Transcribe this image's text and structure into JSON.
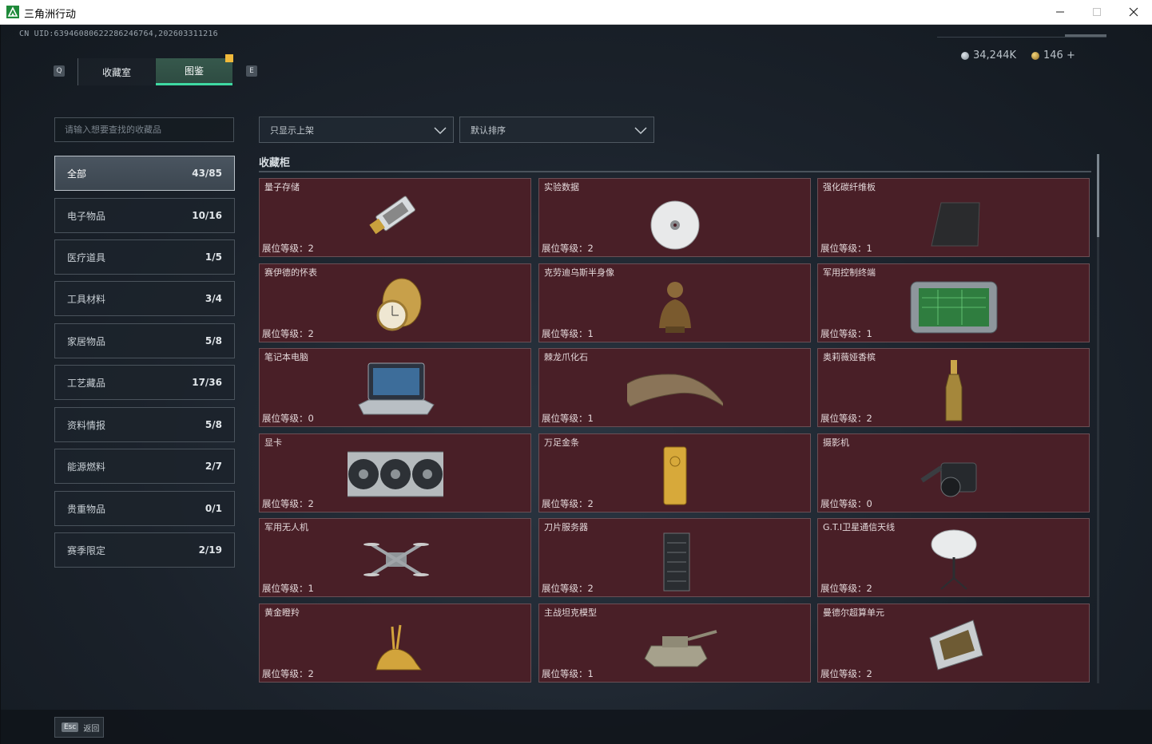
{
  "window": {
    "title": "三角洲行动"
  },
  "uid": "CN UID:6394608062228624676​4,202603311216",
  "tabs": {
    "prev_key": "Q",
    "next_key": "E",
    "collection": "收藏室",
    "gallery": "图鉴"
  },
  "currency": {
    "silver": "34,244K",
    "gold": "146 +"
  },
  "search": {
    "placeholder": "请输入想要查找的收藏品"
  },
  "categories": [
    {
      "label": "全部",
      "count": "43/85"
    },
    {
      "label": "电子物品",
      "count": "10/16"
    },
    {
      "label": "医疗道具",
      "count": "1/5"
    },
    {
      "label": "工具材料",
      "count": "3/4"
    },
    {
      "label": "家居物品",
      "count": "5/8"
    },
    {
      "label": "工艺藏品",
      "count": "17/36"
    },
    {
      "label": "资料情报",
      "count": "5/8"
    },
    {
      "label": "能源燃料",
      "count": "2/7"
    },
    {
      "label": "贵重物品",
      "count": "0/1"
    },
    {
      "label": "赛季限定",
      "count": "2/19"
    }
  ],
  "filters": {
    "show": "只显示上架",
    "sort": "默认排序"
  },
  "section": {
    "title": "收藏柜"
  },
  "level_prefix": "展位等级：",
  "items": [
    {
      "name": "量子存储",
      "level": "2",
      "icon": "usb-drive-icon"
    },
    {
      "name": "实验数据",
      "level": "2",
      "icon": "disc-icon"
    },
    {
      "name": "强化碳纤维板",
      "level": "1",
      "icon": "carbon-plate-icon"
    },
    {
      "name": "赛伊德的怀表",
      "level": "2",
      "icon": "pocket-watch-icon"
    },
    {
      "name": "克劳迪乌斯半身像",
      "level": "1",
      "icon": "bust-icon"
    },
    {
      "name": "军用控制终端",
      "level": "1",
      "icon": "control-terminal-icon"
    },
    {
      "name": "笔记本电脑",
      "level": "0",
      "icon": "laptop-icon"
    },
    {
      "name": "棘龙爪化石",
      "level": "1",
      "icon": "claw-fossil-icon"
    },
    {
      "name": "奥莉薇娅香槟",
      "level": "2",
      "icon": "champagne-icon"
    },
    {
      "name": "显卡",
      "level": "2",
      "icon": "graphics-card-icon"
    },
    {
      "name": "万足金条",
      "level": "2",
      "icon": "gold-bar-icon"
    },
    {
      "name": "摄影机",
      "level": "0",
      "icon": "camera-icon"
    },
    {
      "name": "军用无人机",
      "level": "1",
      "icon": "drone-icon"
    },
    {
      "name": "刀片服务器",
      "level": "2",
      "icon": "server-icon"
    },
    {
      "name": "G.T.I卫星通信天线",
      "level": "2",
      "icon": "satellite-dish-icon"
    },
    {
      "name": "黄金瞪羚",
      "level": "2",
      "icon": "gold-gazelle-icon"
    },
    {
      "name": "主战坦克模型",
      "level": "1",
      "icon": "tank-model-icon"
    },
    {
      "name": "曼德尔超算单元",
      "level": "2",
      "icon": "cpu-unit-icon"
    }
  ],
  "footer": {
    "esc_key": "Esc",
    "esc_label": "返回"
  },
  "colors": {
    "accent": "#3fd9a2",
    "card_bg": "#491f27",
    "alert": "#f0b93b"
  }
}
